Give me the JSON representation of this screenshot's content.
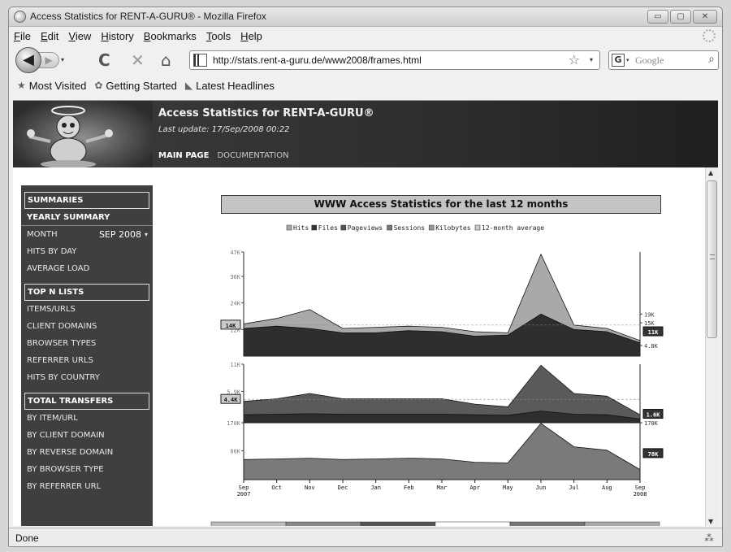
{
  "window": {
    "title": "Access Statistics for RENT-A-GURU® - Mozilla Firefox",
    "buttons": {
      "minimize": "▭",
      "maximize": "▢",
      "close": "✕"
    }
  },
  "menu": [
    "File",
    "Edit",
    "View",
    "History",
    "Bookmarks",
    "Tools",
    "Help"
  ],
  "nav": {
    "back": "◀",
    "forward": "▶",
    "dropdown": "▾",
    "reload": "C",
    "stop": "✕",
    "home": "⌂",
    "url": "http://stats.rent-a-guru.de/www2008/frames.html",
    "star": "☆",
    "url_dropdown": "▾",
    "search_engine_icon": "G",
    "search_engine_dropdown": "▾",
    "search_placeholder": "Google",
    "search_icon": "⌕"
  },
  "bookmarks": [
    {
      "label": "Most Visited",
      "icon": "★"
    },
    {
      "label": "Getting Started",
      "icon": "✿"
    },
    {
      "label": "Latest Headlines",
      "icon": "◣"
    }
  ],
  "site": {
    "title": "Access Statistics for RENT-A-GURU®",
    "last_update": "Last update: 17/Sep/2008 00:22",
    "nav": [
      "MAIN PAGE",
      "DOCUMENTATION"
    ]
  },
  "sidebar": {
    "sections": [
      {
        "title": "SUMMARIES",
        "items": [
          "YEARLY SUMMARY",
          "MONTH",
          "HITS BY DAY",
          "AVERAGE LOAD"
        ],
        "month_value": "SEP 2008",
        "month_arrow": "▾"
      },
      {
        "title": "TOP N LISTS",
        "items": [
          "ITEMS/URLS",
          "CLIENT DOMAINS",
          "BROWSER TYPES",
          "REFERRER URLS",
          "HITS BY COUNTRY"
        ]
      },
      {
        "title": "TOTAL TRANSFERS",
        "items": [
          "BY ITEM/URL",
          "BY CLIENT DOMAIN",
          "BY REVERSE DOMAIN",
          "BY BROWSER TYPE",
          "BY REFERRER URL"
        ]
      }
    ]
  },
  "main": {
    "chart_title": "WWW Access Statistics for the last 12 months"
  },
  "scrollbar": {
    "up": "▲",
    "down": "▼"
  },
  "status": {
    "text": "Done",
    "resize_icon": "⁂"
  },
  "chart_data": {
    "type": "area",
    "categories": [
      "Sep 2007",
      "Oct",
      "Nov",
      "Dec",
      "Jan",
      "Feb",
      "Mar",
      "Apr",
      "May",
      "Jun",
      "Jul",
      "Aug",
      "Sep 2008"
    ],
    "x_tick_labels": [
      {
        "top": "Sep",
        "bottom": "2007"
      },
      {
        "top": "Oct"
      },
      {
        "top": "Nov"
      },
      {
        "top": "Dec"
      },
      {
        "top": "Jan"
      },
      {
        "top": "Feb"
      },
      {
        "top": "Mar"
      },
      {
        "top": "Apr"
      },
      {
        "top": "May"
      },
      {
        "top": "Jun"
      },
      {
        "top": "Jul"
      },
      {
        "top": "Aug"
      },
      {
        "top": "Sep",
        "bottom": "2008"
      }
    ],
    "legend": [
      "Hits",
      "Files",
      "Pageviews",
      "Sessions",
      "Kilobytes",
      "12-month average"
    ],
    "legend_colors": [
      "#aaaaaa",
      "#333333",
      "#555555",
      "#777777",
      "#999999",
      "#cccccc"
    ],
    "panels": [
      {
        "name": "hits-files",
        "ylim": [
          0,
          47000
        ],
        "yticks": [
          {
            "value": 12000,
            "label": "12K"
          },
          {
            "value": 24000,
            "label": "24K"
          },
          {
            "value": 36000,
            "label": "36K"
          },
          {
            "value": 47000,
            "label": "47K"
          }
        ],
        "right_ticks": [
          {
            "value": 19000,
            "label": "19K"
          },
          {
            "value": 15000,
            "label": "15K"
          },
          {
            "value": 4800,
            "label": "4.8K"
          }
        ],
        "left_avg": {
          "value": 14000,
          "label": "14K"
        },
        "right_avg": {
          "value": 11000,
          "label": "11K"
        },
        "series": [
          {
            "name": "Hits",
            "color": "#a9a9a9",
            "values": [
              14500,
              17000,
              21000,
              12500,
              13000,
              13500,
              13000,
              11000,
              10500,
              46000,
              14000,
              12500,
              7000
            ]
          },
          {
            "name": "Files",
            "color": "#2e2e2e",
            "values": [
              12500,
              13500,
              12500,
              10500,
              10500,
              11500,
              11000,
              9000,
              9500,
              19000,
              12000,
              11000,
              6000
            ]
          }
        ]
      },
      {
        "name": "pageviews-sessions",
        "ylim": [
          0,
          11000
        ],
        "yticks": [
          {
            "value": 11000,
            "label": "11K"
          },
          {
            "value": 5900,
            "label": "5.9K"
          }
        ],
        "left_avg": {
          "value": 4400,
          "label": "4.4K"
        },
        "right_avg": {
          "value": 1600,
          "label": "1.6K"
        },
        "series": [
          {
            "name": "Pageviews",
            "color": "#5a5a5a",
            "values": [
              4000,
              4500,
              5500,
              4500,
              4500,
              4500,
              4500,
              3500,
              3000,
              10800,
              5500,
              5000,
              1500
            ]
          },
          {
            "name": "Sessions",
            "color": "#2e2e2e",
            "values": [
              1500,
              1600,
              1700,
              1600,
              1600,
              1600,
              1600,
              1500,
              1400,
              2200,
              1600,
              1500,
              700
            ]
          }
        ]
      },
      {
        "name": "kilobytes",
        "ylim": [
          0,
          170000
        ],
        "yticks": [
          {
            "value": 170000,
            "label": "170K"
          },
          {
            "value": 86000,
            "label": "86K"
          }
        ],
        "right_ticks": [
          {
            "value": 170000,
            "label": "170K"
          }
        ],
        "right_avg": {
          "value": 78000,
          "label": "78K"
        },
        "series": [
          {
            "name": "Kilobytes",
            "color": "#7a7a7a",
            "values": [
              60000,
              62000,
              64000,
              60000,
              62000,
              64000,
              62000,
              52000,
              50000,
              168000,
              98000,
              88000,
              30000
            ]
          }
        ]
      }
    ],
    "grid": false,
    "legend_position": "top"
  }
}
